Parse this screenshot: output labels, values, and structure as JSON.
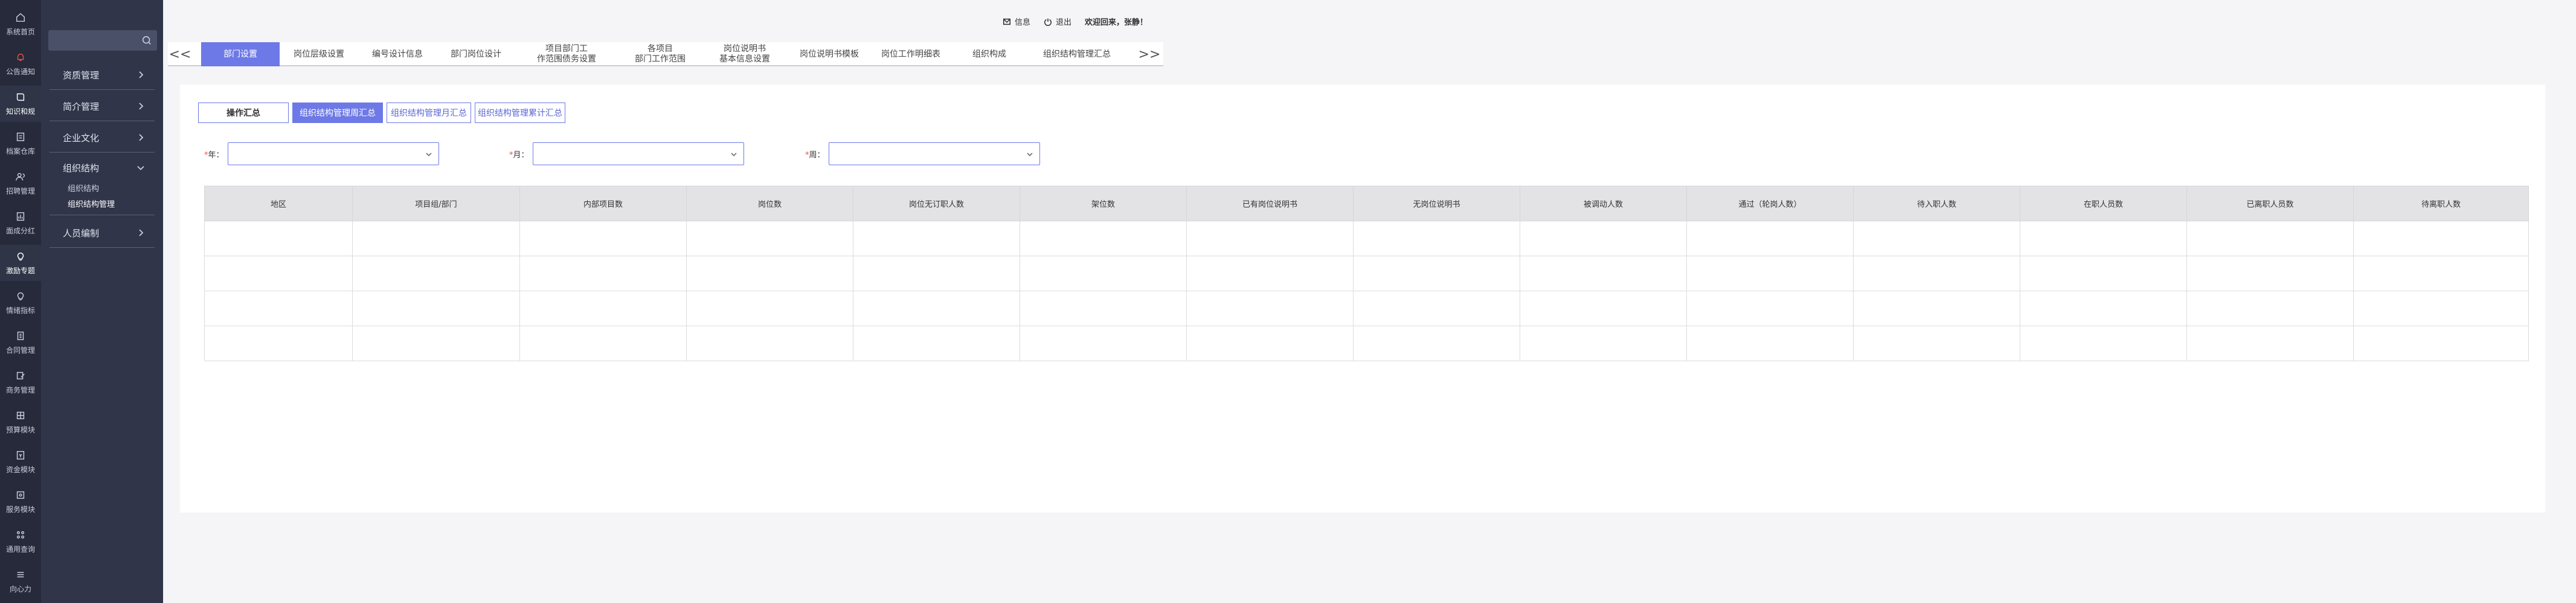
{
  "rail": {
    "items": [
      {
        "label": "系统首页",
        "icon": "home-icon"
      },
      {
        "label": "公告通知",
        "icon": "bell-icon"
      },
      {
        "label": "知识和规",
        "icon": "book-icon"
      },
      {
        "label": "档案仓库",
        "icon": "archive-icon"
      },
      {
        "label": "招聘管理",
        "icon": "people-icon"
      },
      {
        "label": "面成分红",
        "icon": "chart-icon"
      },
      {
        "label": "激励专题",
        "icon": "bulb-icon"
      },
      {
        "label": "情绪指标",
        "icon": "bulb-icon"
      },
      {
        "label": "合同管理",
        "icon": "document-icon"
      },
      {
        "label": "商务管理",
        "icon": "edit-icon"
      },
      {
        "label": "预算模块",
        "icon": "grid-icon"
      },
      {
        "label": "资金模块",
        "icon": "money-icon"
      },
      {
        "label": "服务模块",
        "icon": "service-icon"
      },
      {
        "label": "通用查询",
        "icon": "apps-icon"
      },
      {
        "label": "向心力",
        "icon": "list-icon"
      }
    ]
  },
  "sidebar": {
    "search_placeholder": "",
    "menu": [
      {
        "label": "资质管理"
      },
      {
        "label": "简介管理"
      },
      {
        "label": "企业文化"
      },
      {
        "label": "组织结构"
      },
      {
        "label": "人员编制"
      }
    ],
    "submenu": [
      {
        "label": "组织结构"
      },
      {
        "label": "组织结构管理"
      }
    ]
  },
  "header": {
    "messages": "信息",
    "logout": "退出",
    "welcome": "欢迎回来，张静！"
  },
  "tabs": {
    "prev": "<<",
    "next": ">>",
    "items": [
      {
        "line1": "部门设置",
        "line2": ""
      },
      {
        "line1": "岗位层级设置",
        "line2": ""
      },
      {
        "line1": "编号设计信息",
        "line2": ""
      },
      {
        "line1": "部门岗位设计",
        "line2": ""
      },
      {
        "line1": "项目部门工",
        "line2": "作范围债务设置"
      },
      {
        "line1": "各项目",
        "line2": "部门工作范围"
      },
      {
        "line1": "岗位说明书",
        "line2": "基本信息设置"
      },
      {
        "line1": "岗位说明书模板",
        "line2": ""
      },
      {
        "line1": "岗位工作明细表",
        "line2": ""
      },
      {
        "line1": "组织构成",
        "line2": ""
      },
      {
        "line1": "组织结构管理汇总",
        "line2": ""
      }
    ]
  },
  "subtabs": [
    {
      "label": "操作汇总"
    },
    {
      "label": "组织结构管理周汇总"
    },
    {
      "label": "组织结构管理月汇总"
    },
    {
      "label": "组织结构管理累计汇总"
    }
  ],
  "filters": {
    "year": {
      "required": "*",
      "label": "年：",
      "value": ""
    },
    "month": {
      "required": "*",
      "label": "月：",
      "value": ""
    },
    "week": {
      "required": "*",
      "label": "周：",
      "value": ""
    }
  },
  "table": {
    "columns": [
      "地区",
      "项目组/部门",
      "内部项目数",
      "岗位数",
      "岗位无订职人数",
      "架位数",
      "已有岗位说明书",
      "无岗位说明书",
      "被调动人数",
      "通过（轮岗人数）",
      "待入职人数",
      "在职人员数",
      "已离职人员数",
      "待离职人数"
    ],
    "rows": [
      [
        "",
        "",
        "",
        "",
        "",
        "",
        "",
        "",
        "",
        "",
        "",
        "",
        "",
        ""
      ],
      [
        "",
        "",
        "",
        "",
        "",
        "",
        "",
        "",
        "",
        "",
        "",
        "",
        "",
        ""
      ],
      [
        "",
        "",
        "",
        "",
        "",
        "",
        "",
        "",
        "",
        "",
        "",
        "",
        "",
        ""
      ],
      [
        "",
        "",
        "",
        "",
        "",
        "",
        "",
        "",
        "",
        "",
        "",
        "",
        "",
        ""
      ]
    ]
  },
  "colors": {
    "accent": "#6d79e6",
    "rail_bg": "#262a3a",
    "sidebar_bg": "#30354a",
    "required": "#e8533f"
  }
}
